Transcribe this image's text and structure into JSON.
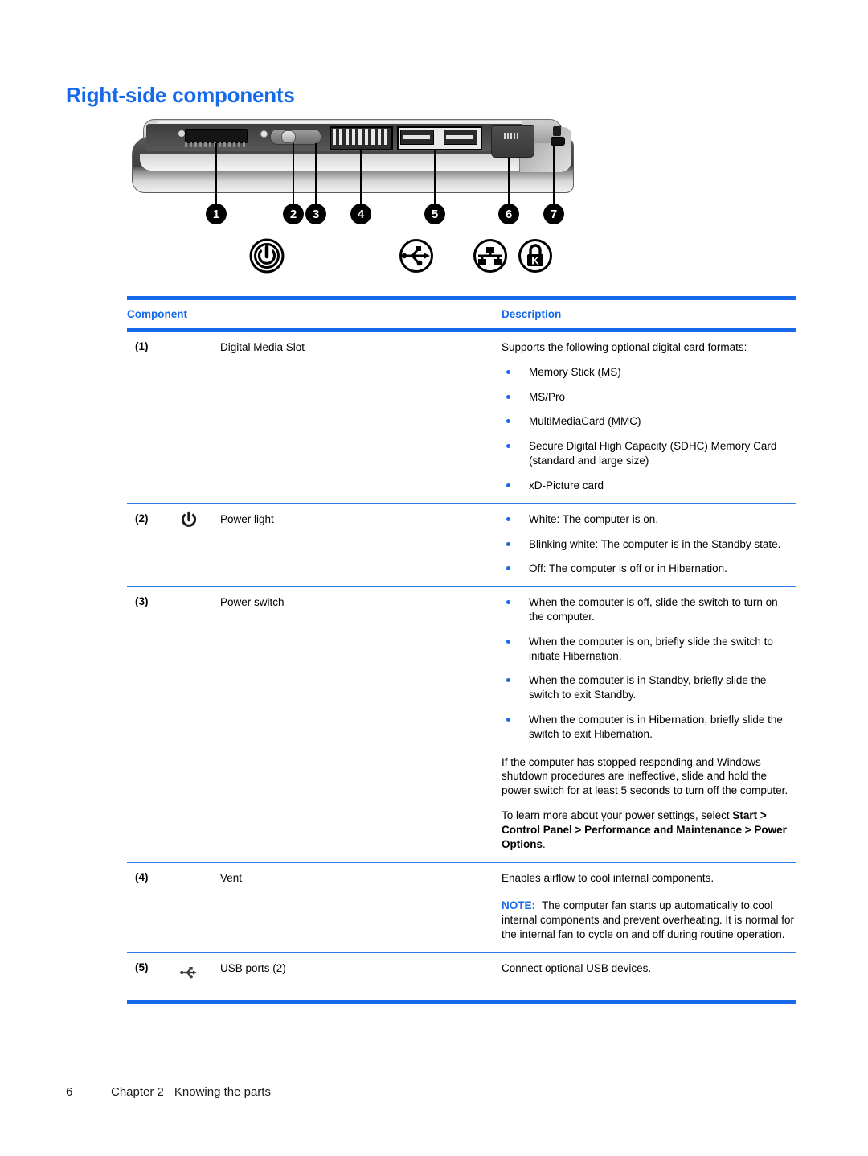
{
  "document": {
    "title": "Right-side components"
  },
  "figure": {
    "name": "laptop-right-side-diagram",
    "callouts": [
      {
        "number": "1",
        "target": "digital-media-slot"
      },
      {
        "number": "2",
        "target": "power-light"
      },
      {
        "number": "3",
        "target": "power-switch"
      },
      {
        "number": "4",
        "target": "vent"
      },
      {
        "number": "5",
        "target": "usb-ports"
      },
      {
        "number": "6",
        "target": "rj45-network-jack"
      },
      {
        "number": "7",
        "target": "security-cable-slot"
      }
    ],
    "icons": [
      {
        "name": "power-icon",
        "for_callout": "2"
      },
      {
        "name": "usb-icon",
        "for_callout": "5"
      },
      {
        "name": "network-rj45-icon",
        "for_callout": "6"
      },
      {
        "name": "security-lock-icon",
        "for_callout": "7"
      }
    ]
  },
  "table": {
    "headers": {
      "component": "Component",
      "description": "Description"
    },
    "rows": [
      {
        "num": "(1)",
        "icon": null,
        "component": "Digital Media Slot",
        "description_intro": "Supports the following optional digital card formats:",
        "bullets": [
          "Memory Stick (MS)",
          "MS/Pro",
          "MultiMediaCard (MMC)",
          "Secure Digital High Capacity (SDHC) Memory Card (standard and large size)",
          "xD-Picture card"
        ]
      },
      {
        "num": "(2)",
        "icon": "power-icon",
        "component": "Power light",
        "description_intro": null,
        "bullets": [
          "White: The computer is on.",
          "Blinking white: The computer is in the Standby state.",
          "Off: The computer is off or in Hibernation."
        ]
      },
      {
        "num": "(3)",
        "icon": null,
        "component": "Power switch",
        "description_intro": null,
        "bullets": [
          "When the computer is off, slide the switch to turn on the computer.",
          "When the computer is on, briefly slide the switch to initiate Hibernation.",
          "When the computer is in Standby, briefly slide the switch to exit Standby.",
          "When the computer is in Hibernation, briefly slide the switch to exit Hibernation."
        ],
        "paragraph_1": "If the computer has stopped responding and Windows shutdown procedures are ineffective, slide and hold the power switch for at least 5 seconds to turn off the computer.",
        "paragraph_2_lead": "To learn more about your power settings, select ",
        "paragraph_2_path_1": "Start",
        "paragraph_2_sep_1": " > ",
        "paragraph_2_path_2": "Control Panel",
        "paragraph_2_sep_2": " > ",
        "paragraph_2_path_3": "Performance and Maintenance",
        "paragraph_2_sep_3": " > ",
        "paragraph_2_path_4": "Power Options",
        "paragraph_2_end": "."
      },
      {
        "num": "(4)",
        "icon": null,
        "component": "Vent",
        "description_intro": "Enables airflow to cool internal components.",
        "note_label": "NOTE:",
        "note_text": "The computer fan starts up automatically to cool internal components and prevent overheating. It is normal for the internal fan to cycle on and off during routine operation."
      },
      {
        "num": "(5)",
        "icon": "usb-icon",
        "component": "USB ports (2)",
        "description_intro": "Connect optional USB devices."
      }
    ]
  },
  "footer": {
    "page_number": "6",
    "chapter": "Chapter 2",
    "chapter_title": "Knowing the parts"
  },
  "colors": {
    "accent_blue": "#1669e8",
    "rule_blue": "#2f7ae5",
    "text_black": "#000000"
  }
}
